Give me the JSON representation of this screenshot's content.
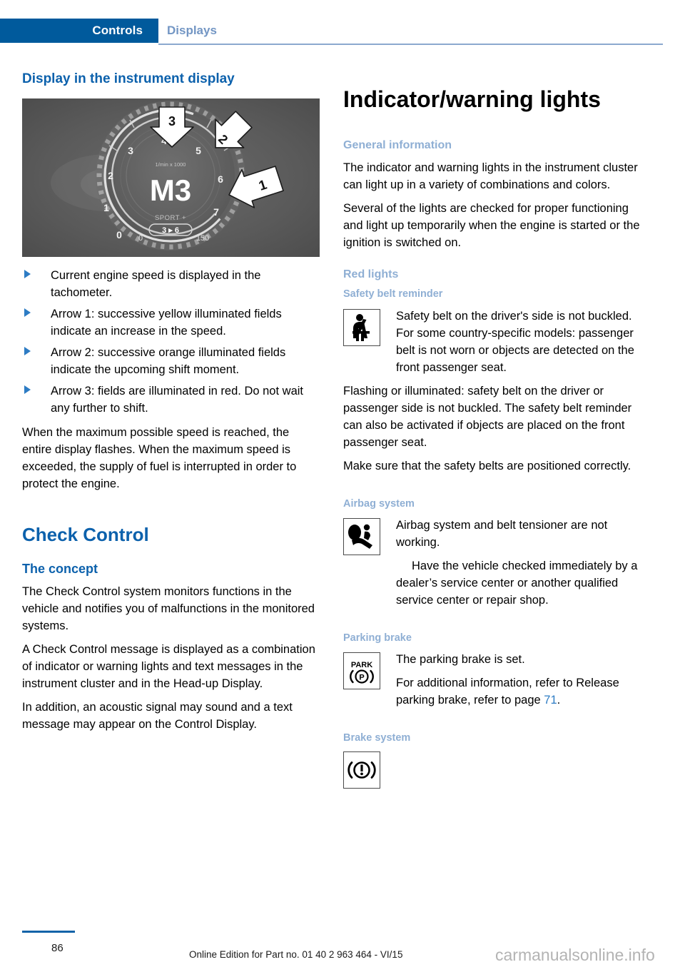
{
  "header": {
    "active_tab": "Controls",
    "inactive_tab": "Displays"
  },
  "left_column": {
    "heading": "Display in the instrument display",
    "figure": {
      "alt_name": "tachometer-instrument-display",
      "gear_display": "M3",
      "unit_label": "1/min x 1000",
      "scale_numbers": [
        "0",
        "1",
        "2",
        "3",
        "4",
        "5",
        "6",
        "7"
      ],
      "sport_label": "SPORT +",
      "shift_indicator": "3 ▸ 6",
      "speed_low": "0",
      "speed_high": "150",
      "arrow_labels": [
        "1",
        "2",
        "3"
      ]
    },
    "bullets": [
      "Current engine speed is displayed in the tachometer.",
      "Arrow 1: successive yellow illuminated fields indicate an increase in the speed.",
      "Arrow 2: successive orange illuminated fields indicate the upcoming shift moment.",
      "Arrow 3: fields are illuminated in red. Do not wait any further to shift."
    ],
    "paragraph_after_bullets": "When the maximum possible speed is reached, the entire display flashes. When the maximum speed is exceeded, the supply of fuel is interrupted in order to protect the engine.",
    "check_control": {
      "title": "Check Control",
      "subheading": "The concept",
      "paragraphs": [
        "The Check Control system monitors functions in the vehicle and notifies you of malfunctions in the monitored systems.",
        "A Check Control message is displayed as a combination of indicator or warning lights and text messages in the instrument cluster and in the Head-up Display.",
        "In addition, an acoustic signal may sound and a text message may appear on the Control Display."
      ]
    }
  },
  "right_column": {
    "heading": "Indicator/warning lights",
    "general_information": {
      "subheading": "General information",
      "paragraphs": [
        "The indicator and warning lights in the instrument cluster can light up in a variety of combinations and colors.",
        "Several of the lights are checked for proper functioning and light up temporarily when the engine is started or the ignition is switched on."
      ]
    },
    "red_lights": {
      "subheading": "Red lights",
      "sections": [
        {
          "title": "Safety belt reminder",
          "icon": "seatbelt-reminder-icon",
          "icon_paragraph": "Safety belt on the driver's side is not buckled. For some country-specific models: passenger belt is not worn or objects are detected on the front passenger seat.",
          "paragraphs": [
            "Flashing or illuminated: safety belt on the driver or passenger side is not buckled. The safety belt reminder can also be activated if objects are placed on the front passenger seat.",
            "Make sure that the safety belts are positioned correctly."
          ]
        },
        {
          "title": "Airbag system",
          "icon": "airbag-system-icon",
          "icon_paragraph": "Airbag system and belt tensioner are not working.",
          "paragraphs": [
            "Have the vehicle checked immediately by a dealer’s service center or another qualified service center or repair shop."
          ]
        },
        {
          "title": "Parking brake",
          "icon": "parking-brake-icon",
          "icon_label_top": "PARK",
          "icon_paragraph": "The parking brake is set.",
          "paragraphs": [
            "For additional information, refer to Release parking brake, refer to page ",
            "."
          ],
          "page_ref": "71"
        },
        {
          "title": "Brake system",
          "icon": "brake-system-icon"
        }
      ]
    }
  },
  "footer": {
    "page_number": "86",
    "edition_text": "Online Edition for Part no. 01 40 2 963 464 - VI/15",
    "watermark": "carmanualsonline.info"
  },
  "colors": {
    "tab_blue": "#005A9C",
    "heading_blue": "#0C61AC",
    "light_blue": "#8FAFD4",
    "link_blue": "#2D7CC4"
  }
}
